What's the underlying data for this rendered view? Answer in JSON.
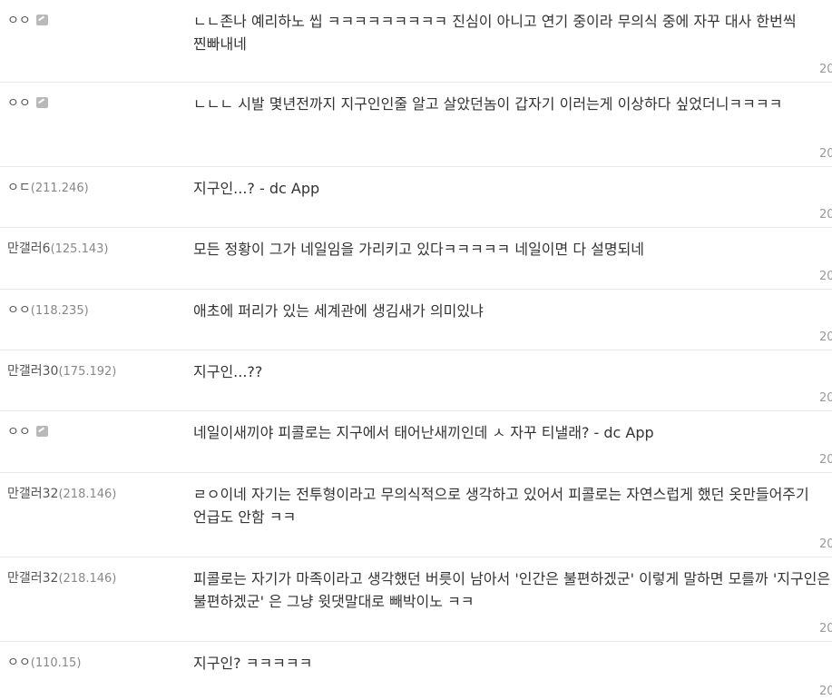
{
  "comments": [
    {
      "nick": "ㅇㅇ",
      "ip": "",
      "fixed": true,
      "text": "ㄴㄴ존나 예리하노 씹 ㅋㅋㅋㅋㅋㅋㅋㅋㅋ 진심이 아니고 연기 중이라 무의식 중에 자꾸 대사 한번씩 찐빠내네",
      "date": "20"
    },
    {
      "nick": "ㅇㅇ",
      "ip": "",
      "fixed": true,
      "text": "ㄴㄴㄴ 시발 몇년전까지 지구인인줄 알고 살았던놈이 갑자기 이러는게 이상하다 싶었더니ㅋㅋㅋㅋ",
      "date": "20"
    },
    {
      "nick": "ㅇㄷ",
      "ip": "(211.246)",
      "fixed": false,
      "text": "지구인...? - dc App",
      "date": "20"
    },
    {
      "nick": "만갤러6",
      "ip": "(125.143)",
      "fixed": false,
      "text": "모든 정황이 그가 네일임을 가리키고 있다ㅋㅋㅋㅋㅋ 네일이면 다 설명되네",
      "date": "20"
    },
    {
      "nick": "ㅇㅇ",
      "ip": "(118.235)",
      "fixed": false,
      "text": "애초에 퍼리가 있는 세계관에 생김새가 의미있냐",
      "date": "20"
    },
    {
      "nick": "만갤러30",
      "ip": "(175.192)",
      "fixed": false,
      "text": "지구인...??",
      "date": "20"
    },
    {
      "nick": "ㅇㅇ",
      "ip": "",
      "fixed": true,
      "text": "네일이새끼야 피콜로는 지구에서 태어난새끼인데 ㅅ 자꾸 티낼래? - dc App",
      "date": "20"
    },
    {
      "nick": "만갤러32",
      "ip": "(218.146)",
      "fixed": false,
      "text": "ㄹㅇ이네 자기는 전투형이라고 무의식적으로 생각하고 있어서 피콜로는 자연스럽게 했던 옷만들어주기 언급도 안함 ㅋㅋ",
      "date": "20"
    },
    {
      "nick": "만갤러32",
      "ip": "(218.146)",
      "fixed": false,
      "text": "피콜로는 자기가 마족이라고 생각했던 버릇이 남아서 '인간은 불편하겠군' 이렇게 말하면 모를까 '지구인은 불편하겠군' 은 그냥 윗댓말대로 빼박이노 ㅋㅋ",
      "date": "20"
    },
    {
      "nick": "ㅇㅇ",
      "ip": "(110.15)",
      "fixed": false,
      "text": "지구인? ㅋㅋㅋㅋㅋ",
      "date": "20"
    }
  ]
}
